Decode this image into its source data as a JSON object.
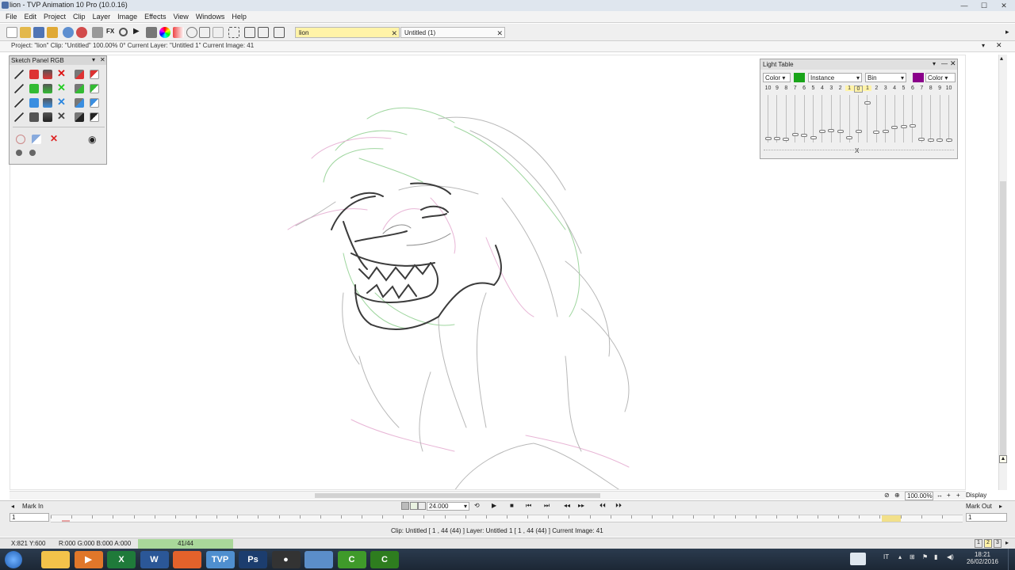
{
  "window": {
    "title": "lion - TVP Animation 10 Pro (10.0.16)"
  },
  "menu": [
    "File",
    "Edit",
    "Project",
    "Clip",
    "Layer",
    "Image",
    "Effects",
    "View",
    "Windows",
    "Help"
  ],
  "tabs": [
    {
      "label": "lion",
      "active": true
    },
    {
      "label": "Untitled (1)",
      "active": false
    }
  ],
  "infobar": "Project: \"lion\"  Clip: \"Untitled\"   100.00%   0°  Current Layer: \"Untitled 1\"  Current Image: 41",
  "sketch_panel": {
    "title": "Sketch Panel RGB",
    "tools": [
      "pencil-icon",
      "eraser-red-icon",
      "brush-icon",
      "delete-red-icon",
      "knife-icon",
      "eraser-icon",
      "pencil-icon",
      "eraser-green-icon",
      "brush-icon",
      "delete-green-icon",
      "knife-icon",
      "eraser-icon",
      "pencil-icon",
      "eraser-blue-icon",
      "brush-icon",
      "delete-blue-icon",
      "knife-icon",
      "eraser-icon",
      "pencil-icon",
      "eraser-black-icon",
      "brush-icon",
      "delete-black-icon",
      "knife-icon",
      "eraser-icon"
    ]
  },
  "light_table": {
    "title": "Light Table",
    "left_color_label": "Color",
    "left_color": "#19a419",
    "mode": "Instance",
    "right_mode": "Bin",
    "right_color": "#8a008a",
    "right_color_label": "Color",
    "numbers": [
      "10",
      "9",
      "8",
      "7",
      "6",
      "5",
      "4",
      "3",
      "2",
      "1",
      "0",
      "1",
      "2",
      "3",
      "4",
      "5",
      "6",
      "7",
      "8",
      "9",
      "10"
    ],
    "center_mark": "X",
    "levels": [
      0.06,
      0.06,
      0.04,
      0.14,
      0.12,
      0.08,
      0.22,
      0.24,
      0.22,
      0.08,
      0.22,
      0.86,
      0.2,
      0.22,
      0.3,
      0.32,
      0.34,
      0.04,
      0.02,
      0.02,
      0.02
    ]
  },
  "view": {
    "zoom": "100.00%",
    "display_label": "Display"
  },
  "timeline": {
    "mark_in": "Mark In",
    "mark_out": "Mark Out",
    "fps": "24.000",
    "start_field": "1",
    "end_field": "1",
    "info": "Clip: Untitled [ 1 , 44  (44) ]     Layer: Untitled 1 [ 1 , 44  (44) ]     Current Image: 41"
  },
  "status": {
    "coords": "X:821  Y:600",
    "rgba": "R:000 G:000 B:000 A:000",
    "frame_counter": "41/44",
    "pages": [
      "1",
      "2",
      "3"
    ]
  },
  "taskbar": {
    "apps": [
      {
        "name": "file-explorer-icon",
        "glyph": "",
        "color": "#f2c24a"
      },
      {
        "name": "media-player-icon",
        "glyph": "▶",
        "color": "#e0772a"
      },
      {
        "name": "excel-icon",
        "glyph": "X",
        "color": "#1f7a3a"
      },
      {
        "name": "word-icon",
        "glyph": "W",
        "color": "#2b5797"
      },
      {
        "name": "firefox-icon",
        "glyph": "",
        "color": "#e3622b"
      },
      {
        "name": "tvpaint-icon",
        "glyph": "TVP",
        "color": "#4f8fcf"
      },
      {
        "name": "photoshop-icon",
        "glyph": "Ps",
        "color": "#1c3d6e"
      },
      {
        "name": "camera-app-icon",
        "glyph": "●",
        "color": "#333333"
      },
      {
        "name": "folder-app-icon",
        "glyph": "",
        "color": "#5b8ec9"
      },
      {
        "name": "camtasia-icon",
        "glyph": "C",
        "color": "#3f9a2a"
      },
      {
        "name": "camtasia-recorder-icon",
        "glyph": "C",
        "color": "#2e7d1f"
      }
    ],
    "lang": "IT",
    "time": "18:21",
    "date": "26/02/2016"
  },
  "colors": {
    "accent_tab": "#fff3a8",
    "frame_bar": "#a9d79a"
  }
}
